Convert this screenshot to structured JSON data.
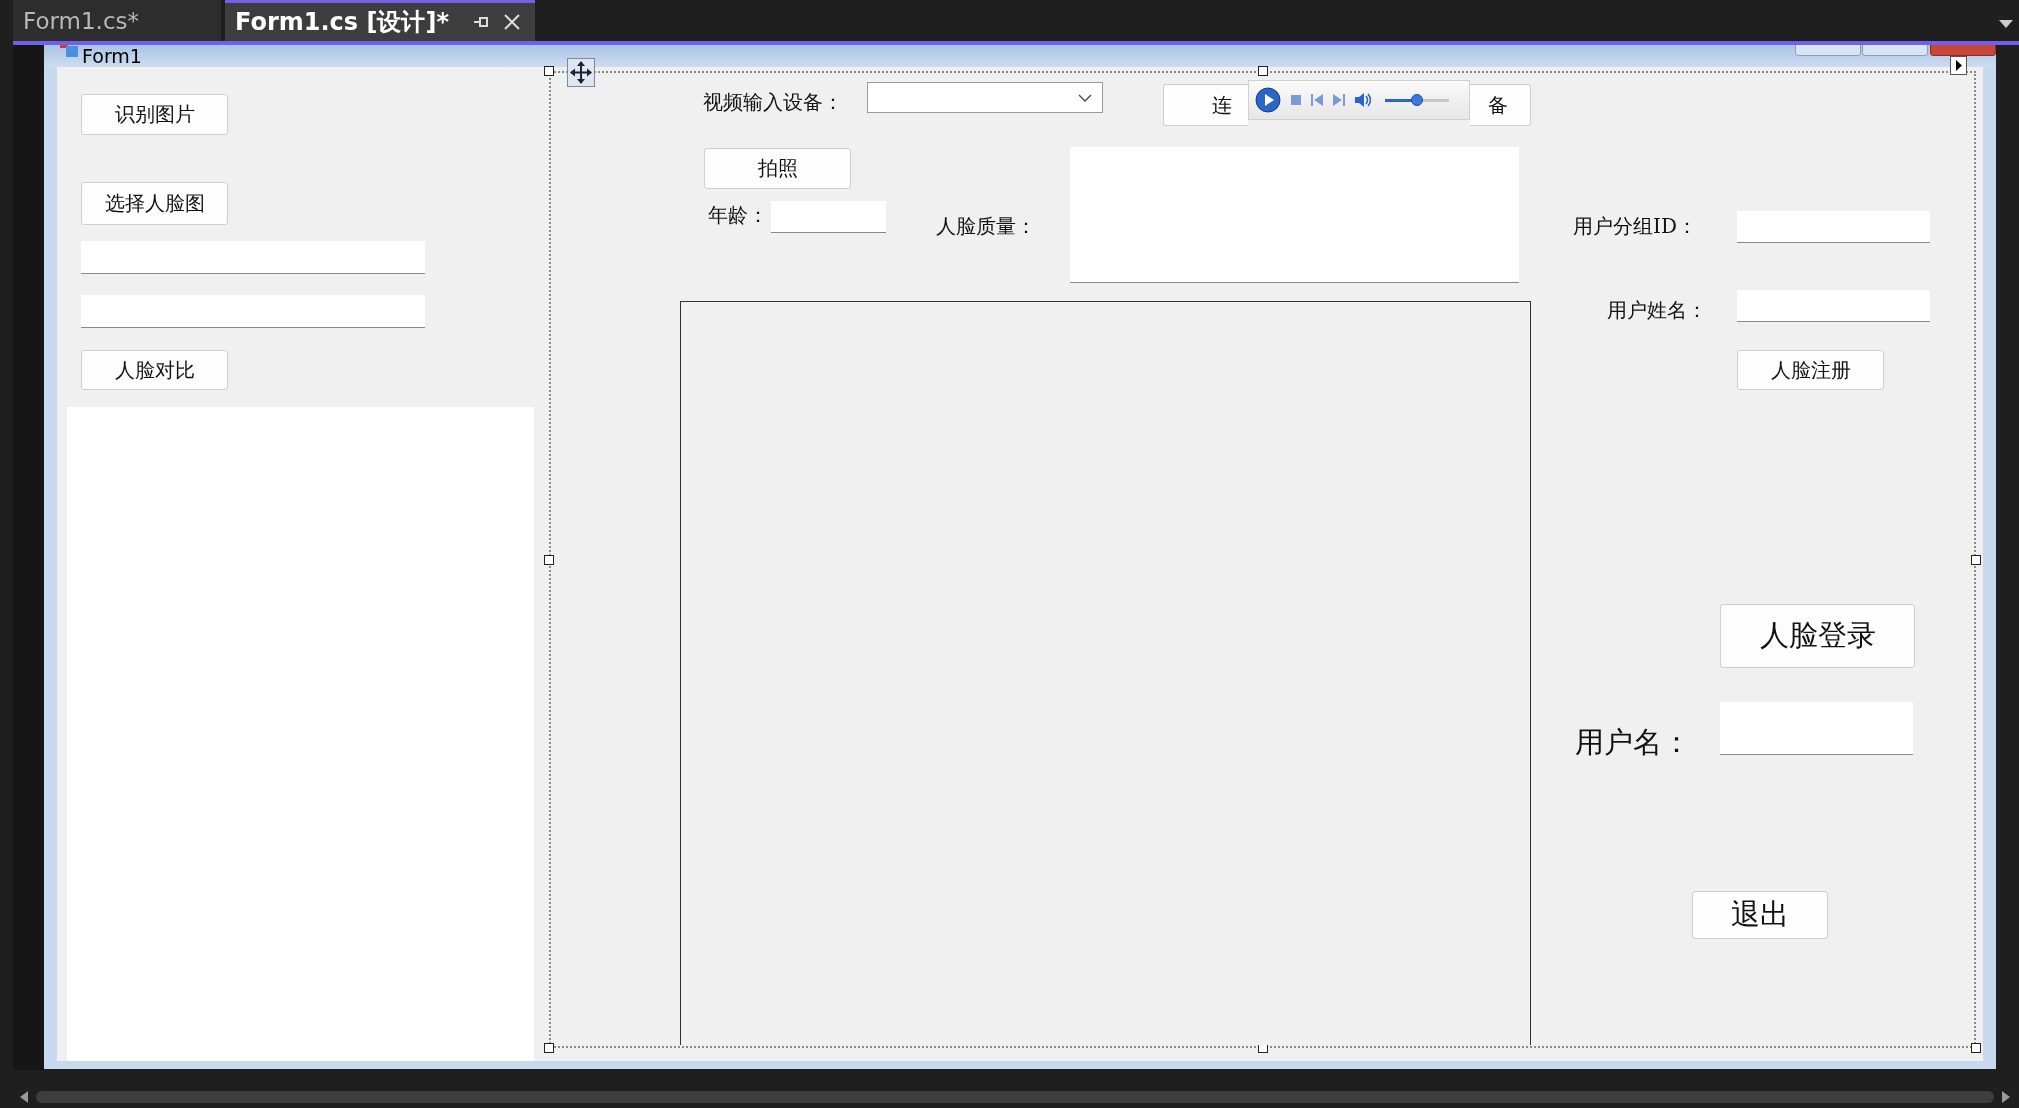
{
  "tabs": [
    {
      "label": "Form1.cs*",
      "selected": false
    },
    {
      "label": "Form1.cs [设计]*",
      "selected": true
    }
  ],
  "form": {
    "title": "Form1"
  },
  "left": {
    "recognize_button": "识别图片",
    "select_face_button": "选择人脸图",
    "compare_button": "人脸对比"
  },
  "video": {
    "device_label": "视频输入设备：",
    "connect_button": "连",
    "device_button": "备",
    "photo_button": "拍照",
    "age_label": "年龄：",
    "quality_label": "人脸质量："
  },
  "media_player": {
    "level": 0.5
  },
  "register": {
    "group_label": "用户分组ID：",
    "name_label": "用户姓名：",
    "register_button": "人脸注册"
  },
  "login": {
    "login_button": "人脸登录",
    "username_label": "用户名：",
    "exit_button": "退出"
  }
}
